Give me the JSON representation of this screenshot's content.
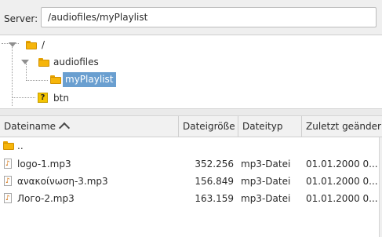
{
  "server": {
    "label": "Server:",
    "path": "/audiofiles/myPlaylist"
  },
  "tree": {
    "items": [
      {
        "label": "/",
        "icon": "folder-icon",
        "expanded": true
      },
      {
        "label": "audiofiles",
        "icon": "folder-icon",
        "expanded": true
      },
      {
        "label": "myPlaylist",
        "icon": "folder-icon",
        "selected": true
      },
      {
        "label": "btn",
        "icon": "unknown-folder-icon"
      }
    ]
  },
  "table": {
    "columns": [
      {
        "label": "Dateiname",
        "sorted": "ascending"
      },
      {
        "label": "Dateigröße"
      },
      {
        "label": "Dateityp"
      },
      {
        "label": "Zuletzt geänder"
      }
    ],
    "rows": [
      {
        "icon": "folder-icon",
        "name": "..",
        "size": "",
        "type": "",
        "modified": ""
      },
      {
        "icon": "audio-file-icon",
        "name": "logo-1.mp3",
        "size": "352.256",
        "type": "mp3-Datei",
        "modified": "01.01.2000 0..."
      },
      {
        "icon": "audio-file-icon",
        "name": "ανακοίνωση-3.mp3",
        "size": "156.849",
        "type": "mp3-Datei",
        "modified": "01.01.2000 0..."
      },
      {
        "icon": "audio-file-icon",
        "name": "Лого-2.mp3",
        "size": "163.159",
        "type": "mp3-Datei",
        "modified": "01.01.2000 0..."
      }
    ]
  },
  "colors": {
    "selection": "#6a9fd0",
    "folder": "#f6b50a",
    "header_bg": "#f1f1f1"
  }
}
